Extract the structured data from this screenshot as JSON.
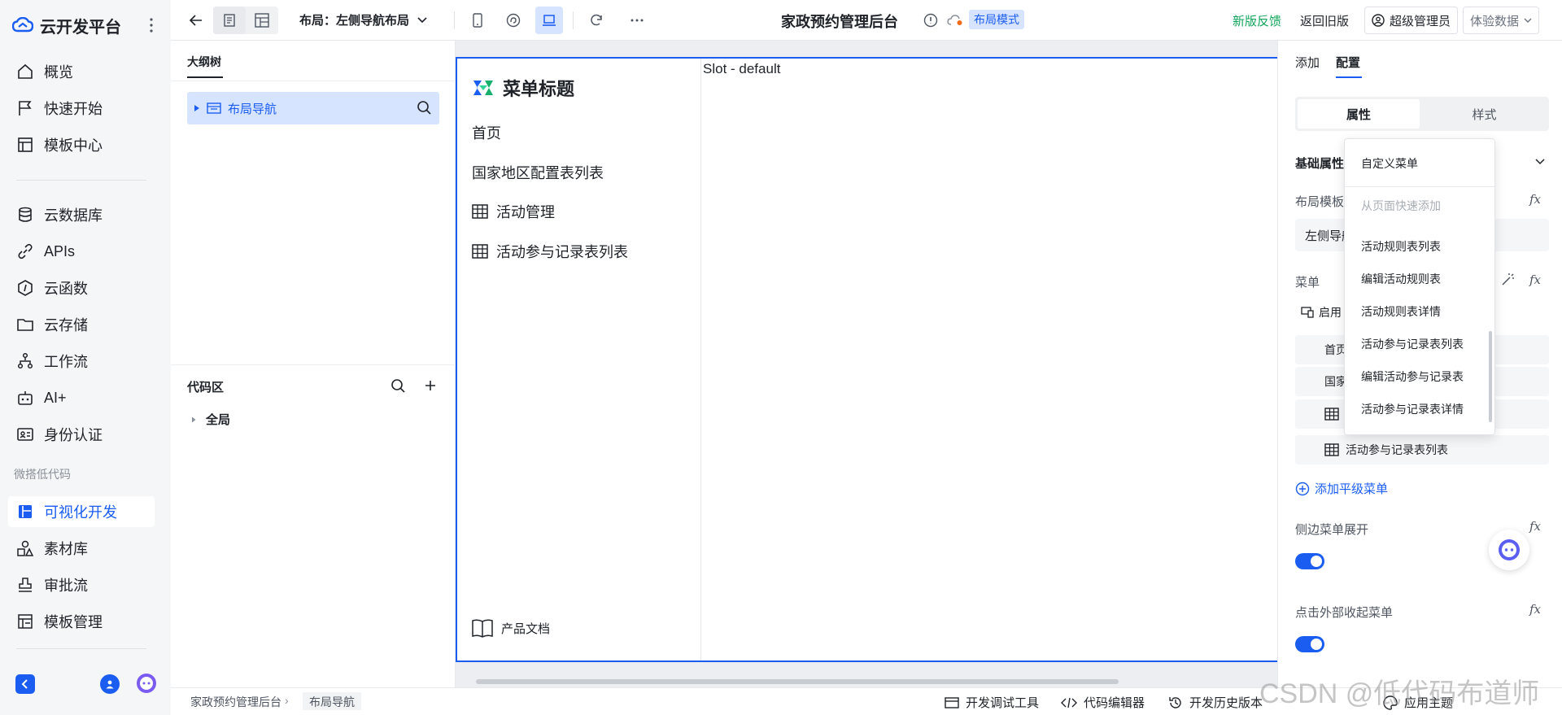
{
  "brand": {
    "name": "云开发平台"
  },
  "sidebar": {
    "items": [
      {
        "label": "概览",
        "icon": "home-icon"
      },
      {
        "label": "快速开始",
        "icon": "flag-icon"
      },
      {
        "label": "模板中心",
        "icon": "template-icon"
      },
      {
        "label": "云数据库",
        "icon": "database-icon"
      },
      {
        "label": "APIs",
        "icon": "link-icon"
      },
      {
        "label": "云函数",
        "icon": "function-icon"
      },
      {
        "label": "云存储",
        "icon": "folder-icon"
      },
      {
        "label": "工作流",
        "icon": "workflow-icon"
      },
      {
        "label": "AI+",
        "icon": "robot-icon"
      },
      {
        "label": "身份认证",
        "icon": "id-card-icon"
      },
      {
        "label": "可视化开发",
        "icon": "layout-icon",
        "active": true
      },
      {
        "label": "素材库",
        "icon": "shapes-icon"
      },
      {
        "label": "审批流",
        "icon": "stamp-icon"
      },
      {
        "label": "模板管理",
        "icon": "template-manage-icon"
      }
    ],
    "section_label": "微搭低代码"
  },
  "topbar": {
    "layout_select": "布局：左侧导航布局",
    "app_title": "家政预约管理后台",
    "mode_badge": "布局模式",
    "new_feedback": "新版反馈",
    "back_old": "返回旧版",
    "user": "超级管理员",
    "data_select": "体验数据"
  },
  "outline": {
    "tab": "大纲树",
    "node": "布局导航",
    "code_title": "代码区",
    "global_node": "全局"
  },
  "canvas": {
    "menu_title": "菜单标题",
    "menu_items": [
      "首页",
      "国家地区配置表列表",
      "活动管理",
      "活动参与记录表列表"
    ],
    "doc_link": "产品文档",
    "slot": "Slot - default"
  },
  "config": {
    "tabs": [
      "添加",
      "配置"
    ],
    "segments": [
      "属性",
      "样式"
    ],
    "basic": "基础属性",
    "layout_template_label": "布局模板",
    "layout_template_value": "左侧导航",
    "menu_label": "菜单",
    "enable_text": "启用",
    "menu_rows": [
      "首页",
      "国家",
      "",
      "活动参与记录表列表"
    ],
    "add_menu": "添加平级菜单",
    "side_expand": "侧边菜单展开",
    "click_collapse": "点击外部收起菜单",
    "fx": "fx"
  },
  "dropdown": {
    "items": [
      {
        "label": "自定义菜单",
        "muted": false
      },
      {
        "label": "从页面快速添加",
        "muted": true
      },
      {
        "label": "活动规则表列表",
        "muted": false
      },
      {
        "label": "编辑活动规则表",
        "muted": false
      },
      {
        "label": "活动规则表详情",
        "muted": false
      },
      {
        "label": "活动参与记录表列表",
        "muted": false
      },
      {
        "label": "编辑活动参与记录表",
        "muted": false
      },
      {
        "label": "活动参与记录表详情",
        "muted": false
      }
    ]
  },
  "bottombar": {
    "crumbs": [
      "家政预约管理后台",
      "布局导航"
    ],
    "tools": [
      "开发调试工具",
      "代码编辑器",
      "开发历史版本",
      "应用主题"
    ]
  },
  "watermark": "CSDN @低代码布道师",
  "colors": {
    "accent": "#1a5df0",
    "green": "#11a55b",
    "badge_bg": "#d6e4ff"
  }
}
